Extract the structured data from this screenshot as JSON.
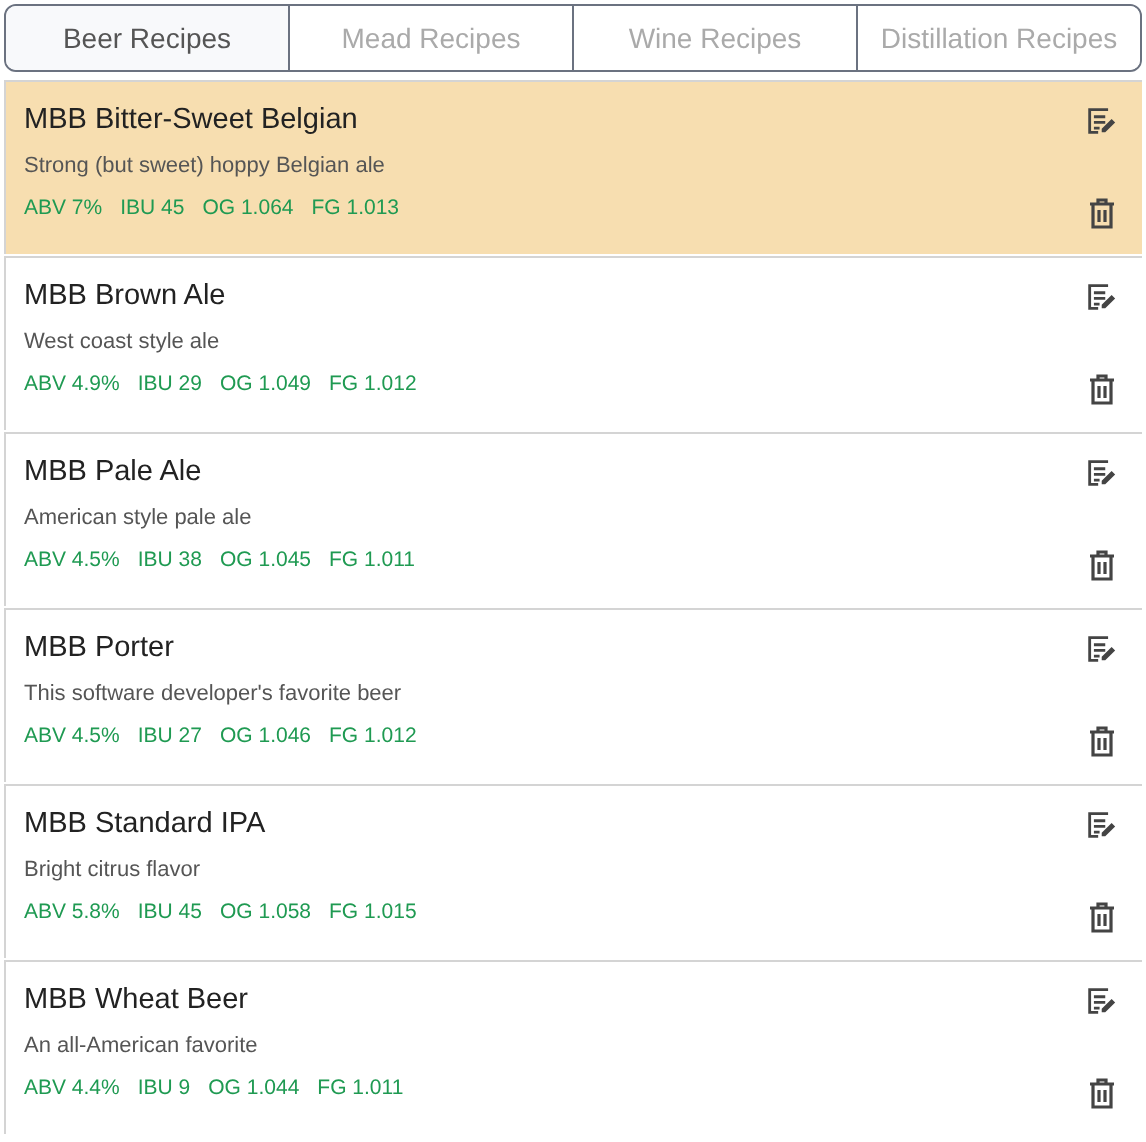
{
  "tabs": [
    {
      "label": "Beer Recipes",
      "selected": true
    },
    {
      "label": "Mead Recipes",
      "selected": false
    },
    {
      "label": "Wine Recipes",
      "selected": false
    },
    {
      "label": "Distillation Recipes",
      "selected": false
    }
  ],
  "recipes": [
    {
      "name": "MBB Bitter-Sweet Belgian",
      "description": "Strong (but sweet) hoppy Belgian ale",
      "stats": [
        "ABV 7%",
        "IBU 45",
        "OG 1.064",
        "FG 1.013"
      ],
      "selected": true
    },
    {
      "name": "MBB Brown Ale",
      "description": "West coast style ale",
      "stats": [
        "ABV 4.9%",
        "IBU 29",
        "OG 1.049",
        "FG 1.012"
      ],
      "selected": false
    },
    {
      "name": "MBB Pale Ale",
      "description": "American style pale ale",
      "stats": [
        "ABV 4.5%",
        "IBU 38",
        "OG 1.045",
        "FG 1.011"
      ],
      "selected": false
    },
    {
      "name": "MBB Porter",
      "description": "This software developer's favorite beer",
      "stats": [
        "ABV 4.5%",
        "IBU 27",
        "OG 1.046",
        "FG 1.012"
      ],
      "selected": false
    },
    {
      "name": "MBB Standard IPA",
      "description": "Bright citrus flavor",
      "stats": [
        "ABV 5.8%",
        "IBU 45",
        "OG 1.058",
        "FG 1.015"
      ],
      "selected": false
    },
    {
      "name": "MBB Wheat Beer",
      "description": "An all-American favorite",
      "stats": [
        "ABV 4.4%",
        "IBU 9",
        "OG 1.044",
        "FG 1.011"
      ],
      "selected": false
    }
  ]
}
